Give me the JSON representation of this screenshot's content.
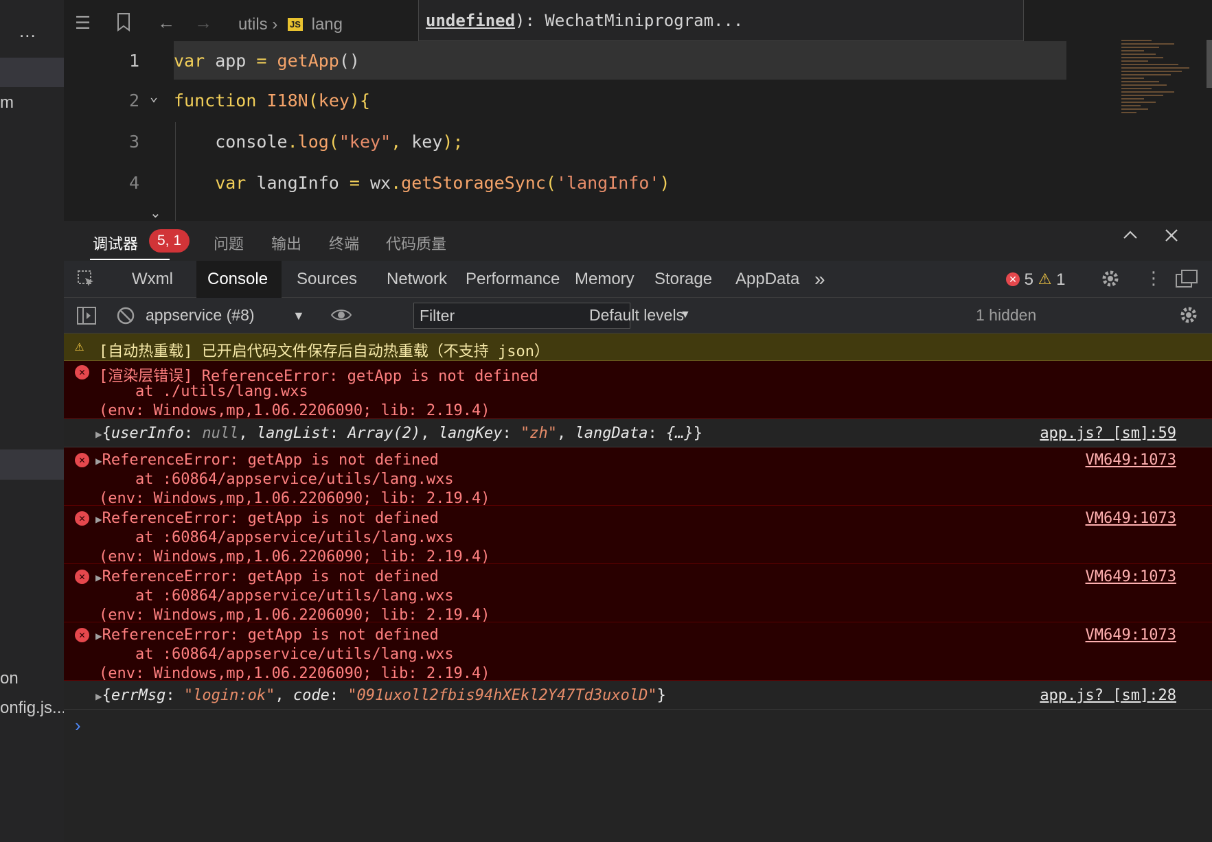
{
  "left_strip": {
    "more": "...",
    "fragments": [
      "m",
      "on",
      "onfig.js..."
    ]
  },
  "editor": {
    "breadcrumb": {
      "folder": "utils",
      "file": "lang"
    },
    "hover": {
      "undefined": "undefined",
      "rest": "): WechatMiniprogram..."
    },
    "lines": [
      {
        "num": "1",
        "parts": [
          [
            "kw",
            "var"
          ],
          [
            "id",
            " app "
          ],
          [
            "kw",
            "="
          ],
          [
            "id",
            " "
          ],
          [
            "fn",
            "getApp"
          ],
          [
            "id",
            "()"
          ]
        ]
      },
      {
        "num": "2",
        "parts": [
          [
            "kw",
            "function"
          ],
          [
            "id",
            " "
          ],
          [
            "fn",
            "I18N"
          ],
          [
            "kw",
            "("
          ],
          [
            "fn",
            "key"
          ],
          [
            "kw",
            "){"
          ]
        ]
      },
      {
        "num": "3",
        "parts": [
          [
            "id",
            "    console"
          ],
          [
            "kw",
            "."
          ],
          [
            "fn",
            "log"
          ],
          [
            "kw",
            "("
          ],
          [
            "str",
            "\"key\""
          ],
          [
            "kw",
            ","
          ],
          [
            "id",
            " key"
          ],
          [
            "kw",
            ");"
          ]
        ]
      },
      {
        "num": "4",
        "parts": [
          [
            "kw",
            "    var"
          ],
          [
            "id",
            " langInfo "
          ],
          [
            "kw",
            "="
          ],
          [
            "id",
            " wx"
          ],
          [
            "kw",
            "."
          ],
          [
            "fn",
            "getStorageSync"
          ],
          [
            "kw",
            "("
          ],
          [
            "str",
            "'langInfo'"
          ],
          [
            "kw",
            ")"
          ]
        ]
      }
    ]
  },
  "panel": {
    "tabs": [
      "调试器",
      "问题",
      "输出",
      "终端",
      "代码质量"
    ],
    "debugger_badge": "5, 1"
  },
  "devtools": {
    "tabs": [
      "Wxml",
      "Console",
      "Sources",
      "Network",
      "Performance",
      "Memory",
      "Storage",
      "AppData"
    ],
    "active_tab": "Console",
    "more": "»",
    "error_count": "5",
    "warning_count": "1"
  },
  "console_toolbar": {
    "context": "appservice (#8)",
    "filter_placeholder": "Filter",
    "levels": "Default levels",
    "hidden": "1 hidden"
  },
  "console": {
    "warn": {
      "text": "[自动热重载] 已开启代码文件保存后自动热重载（不支持 json）"
    },
    "render_error": {
      "l1": "[渲染层错误] ReferenceError: getApp is not defined",
      "l2": "    at ./utils/lang.wxs",
      "l3": "(env: Windows,mp,1.06.2206090; lib: 2.19.4)"
    },
    "log1": {
      "k1": "userInfo",
      "v1": "null",
      "k2": "langList",
      "v2": "Array(2)",
      "k3": "langKey",
      "v3": "\"zh\"",
      "k4": "langData",
      "v4": "{…}",
      "source": "app.js? [sm]:59"
    },
    "errors": [
      {
        "msg": "ReferenceError: getApp is not defined",
        "at": "    at ",
        "link": ":60864/appservice/utils/lang.wxs",
        "env": "(env: Windows,mp,1.06.2206090; lib: 2.19.4)",
        "source": "VM649:1073"
      },
      {
        "msg": "ReferenceError: getApp is not defined",
        "at": "    at ",
        "link": ":60864/appservice/utils/lang.wxs",
        "env": "(env: Windows,mp,1.06.2206090; lib: 2.19.4)",
        "source": "VM649:1073"
      },
      {
        "msg": "ReferenceError: getApp is not defined",
        "at": "    at ",
        "link": ":60864/appservice/utils/lang.wxs",
        "env": "(env: Windows,mp,1.06.2206090; lib: 2.19.4)",
        "source": "VM649:1073"
      },
      {
        "msg": "ReferenceError: getApp is not defined",
        "at": "    at ",
        "link": ":60864/appservice/utils/lang.wxs",
        "env": "(env: Windows,mp,1.06.2206090; lib: 2.19.4)",
        "source": "VM649:1073"
      }
    ],
    "log2": {
      "k1": "errMsg",
      "v1": "\"login:ok\"",
      "k2": "code",
      "v2": "\"091uxoll2fbis94hXEkl2Y47Td3uxolD\"",
      "source": "app.js? [sm]:28"
    },
    "prompt": "›"
  }
}
